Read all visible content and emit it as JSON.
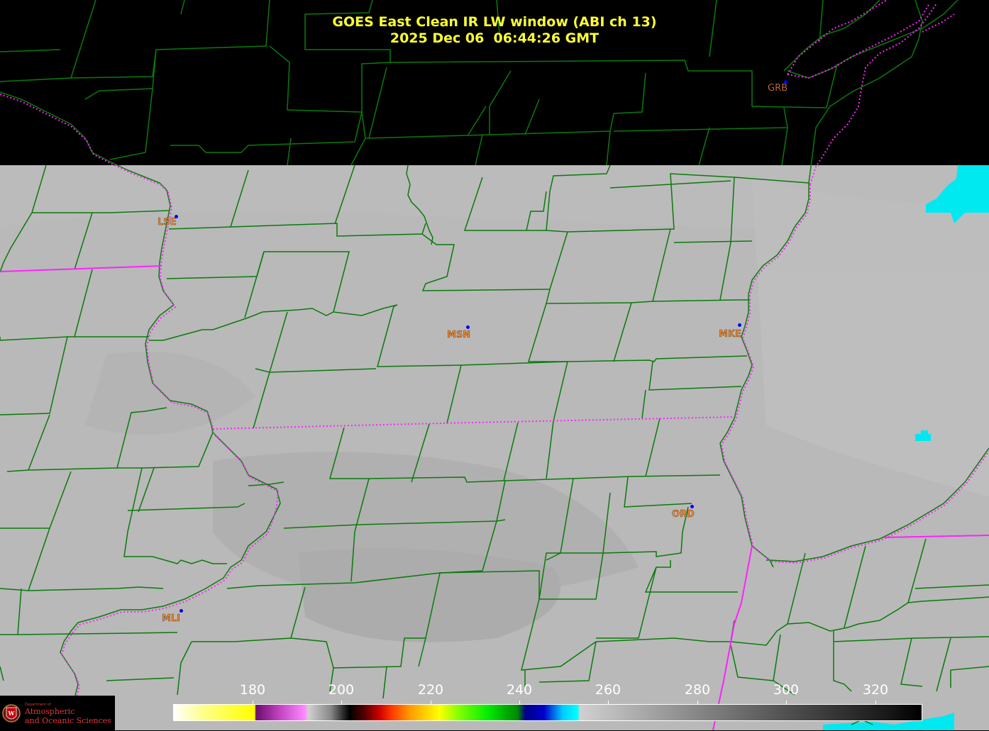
{
  "title": {
    "line1": "GOES East Clean IR LW window (ABI ch 13)",
    "line2": "2025 Dec 06  06:44:26 GMT"
  },
  "stations": [
    {
      "id": "GRB"
    },
    {
      "id": "LSE"
    },
    {
      "id": "MSN"
    },
    {
      "id": "MKE"
    },
    {
      "id": "ORD"
    },
    {
      "id": "MLI"
    }
  ],
  "colorbar": {
    "ticks": [
      "180",
      "200",
      "220",
      "240",
      "260",
      "280",
      "300",
      "320"
    ]
  },
  "logo": {
    "small": "Department of",
    "line1": "Atmospheric",
    "line2": "and Oceanic Sciences"
  },
  "colors": {
    "title": "#ffff33",
    "county_lines": "#0b7a0b",
    "state_lines": "#ff00ff",
    "station_label": "#f08a34",
    "station_dot": "#0000ff",
    "cloud_gray": "#b5b5b5",
    "cold_cloud": "#00e8f0"
  }
}
